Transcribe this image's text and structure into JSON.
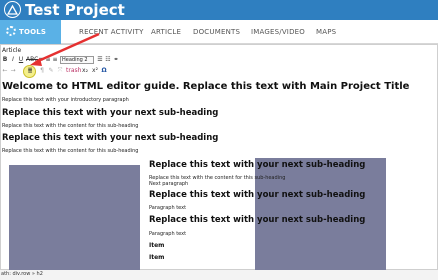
{
  "app": {
    "title": "Test Project"
  },
  "tabs": [
    {
      "label": "TOOLS",
      "active": true
    },
    {
      "label": "RECENT ACTIVITY"
    },
    {
      "label": "ARTICLE"
    },
    {
      "label": "DOCUMENTS"
    },
    {
      "label": "IMAGES/VIDEO"
    },
    {
      "label": "MAPS"
    }
  ],
  "editor": {
    "section_label": "Article",
    "toolbar": {
      "format_select": "Heading 2",
      "row1": [
        "B",
        "I",
        "U",
        "ABC",
        "≡",
        "≡",
        "≡"
      ],
      "row2": [
        "←",
        "→",
        "≣",
        "¶",
        "✎",
        "⤧",
        "trash",
        "x₂",
        "x²",
        "Ω"
      ]
    },
    "content": {
      "title": "Welcome to HTML editor guide. Replace this text with Main Project Title",
      "intro": "Replace this text with your introductory paragraph",
      "sections": [
        {
          "heading": "Replace this text with your next sub-heading",
          "text": "Replace this text with the content for this sub-heading"
        },
        {
          "heading": "Replace this text with your next sub-heading",
          "text": "Replace this text with the content for this sub-heading"
        }
      ],
      "right_column": {
        "heading1": "Replace this text with your next sub-heading",
        "text1": "Replace this text with the content for this sub-heading",
        "text1b": "Next paragraph",
        "heading2": "Replace this text with your next sub-heading",
        "para2": "Paragraph text",
        "heading3": "Replace this text with your next sub-heading",
        "para3": "Paragraph text",
        "item1": "Item",
        "item2": "Item"
      }
    }
  },
  "status": {
    "path": "ath: div.row » h2"
  },
  "colors": {
    "title_bar": "#2f7fc0",
    "tools_tab": "#5ab1e6",
    "image_placeholder": "#7a7d9c",
    "arrow": "#e53030",
    "highlight": "#f4ef8a"
  }
}
